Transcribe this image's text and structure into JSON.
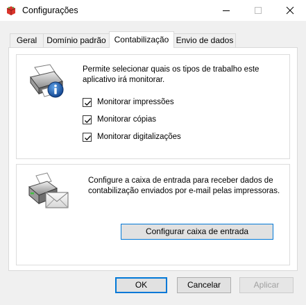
{
  "window": {
    "title": "Configurações"
  },
  "tabs": [
    {
      "label": "Geral",
      "active": false
    },
    {
      "label": "Domínio padrão",
      "active": false
    },
    {
      "label": "Contabilização",
      "active": true
    },
    {
      "label": "Envio de dados",
      "active": false
    }
  ],
  "monitor_section": {
    "description": "Permite selecionar quais os tipos de trabalho este aplicativo irá monitorar.",
    "checkboxes": [
      {
        "label": "Monitorar impressões",
        "checked": true
      },
      {
        "label": "Monitorar cópias",
        "checked": true
      },
      {
        "label": "Monitorar digitalizações",
        "checked": true
      }
    ]
  },
  "inbox_section": {
    "description": "Configure a caixa de entrada para receber dados de contabilização enviados por e-mail pelas impressoras.",
    "button_label": "Configurar caixa de entrada"
  },
  "footer": {
    "ok_label": "OK",
    "cancel_label": "Cancelar",
    "apply_label": "Aplicar"
  },
  "colors": {
    "accent": "#0078d7",
    "app_icon": "#d9342b"
  }
}
